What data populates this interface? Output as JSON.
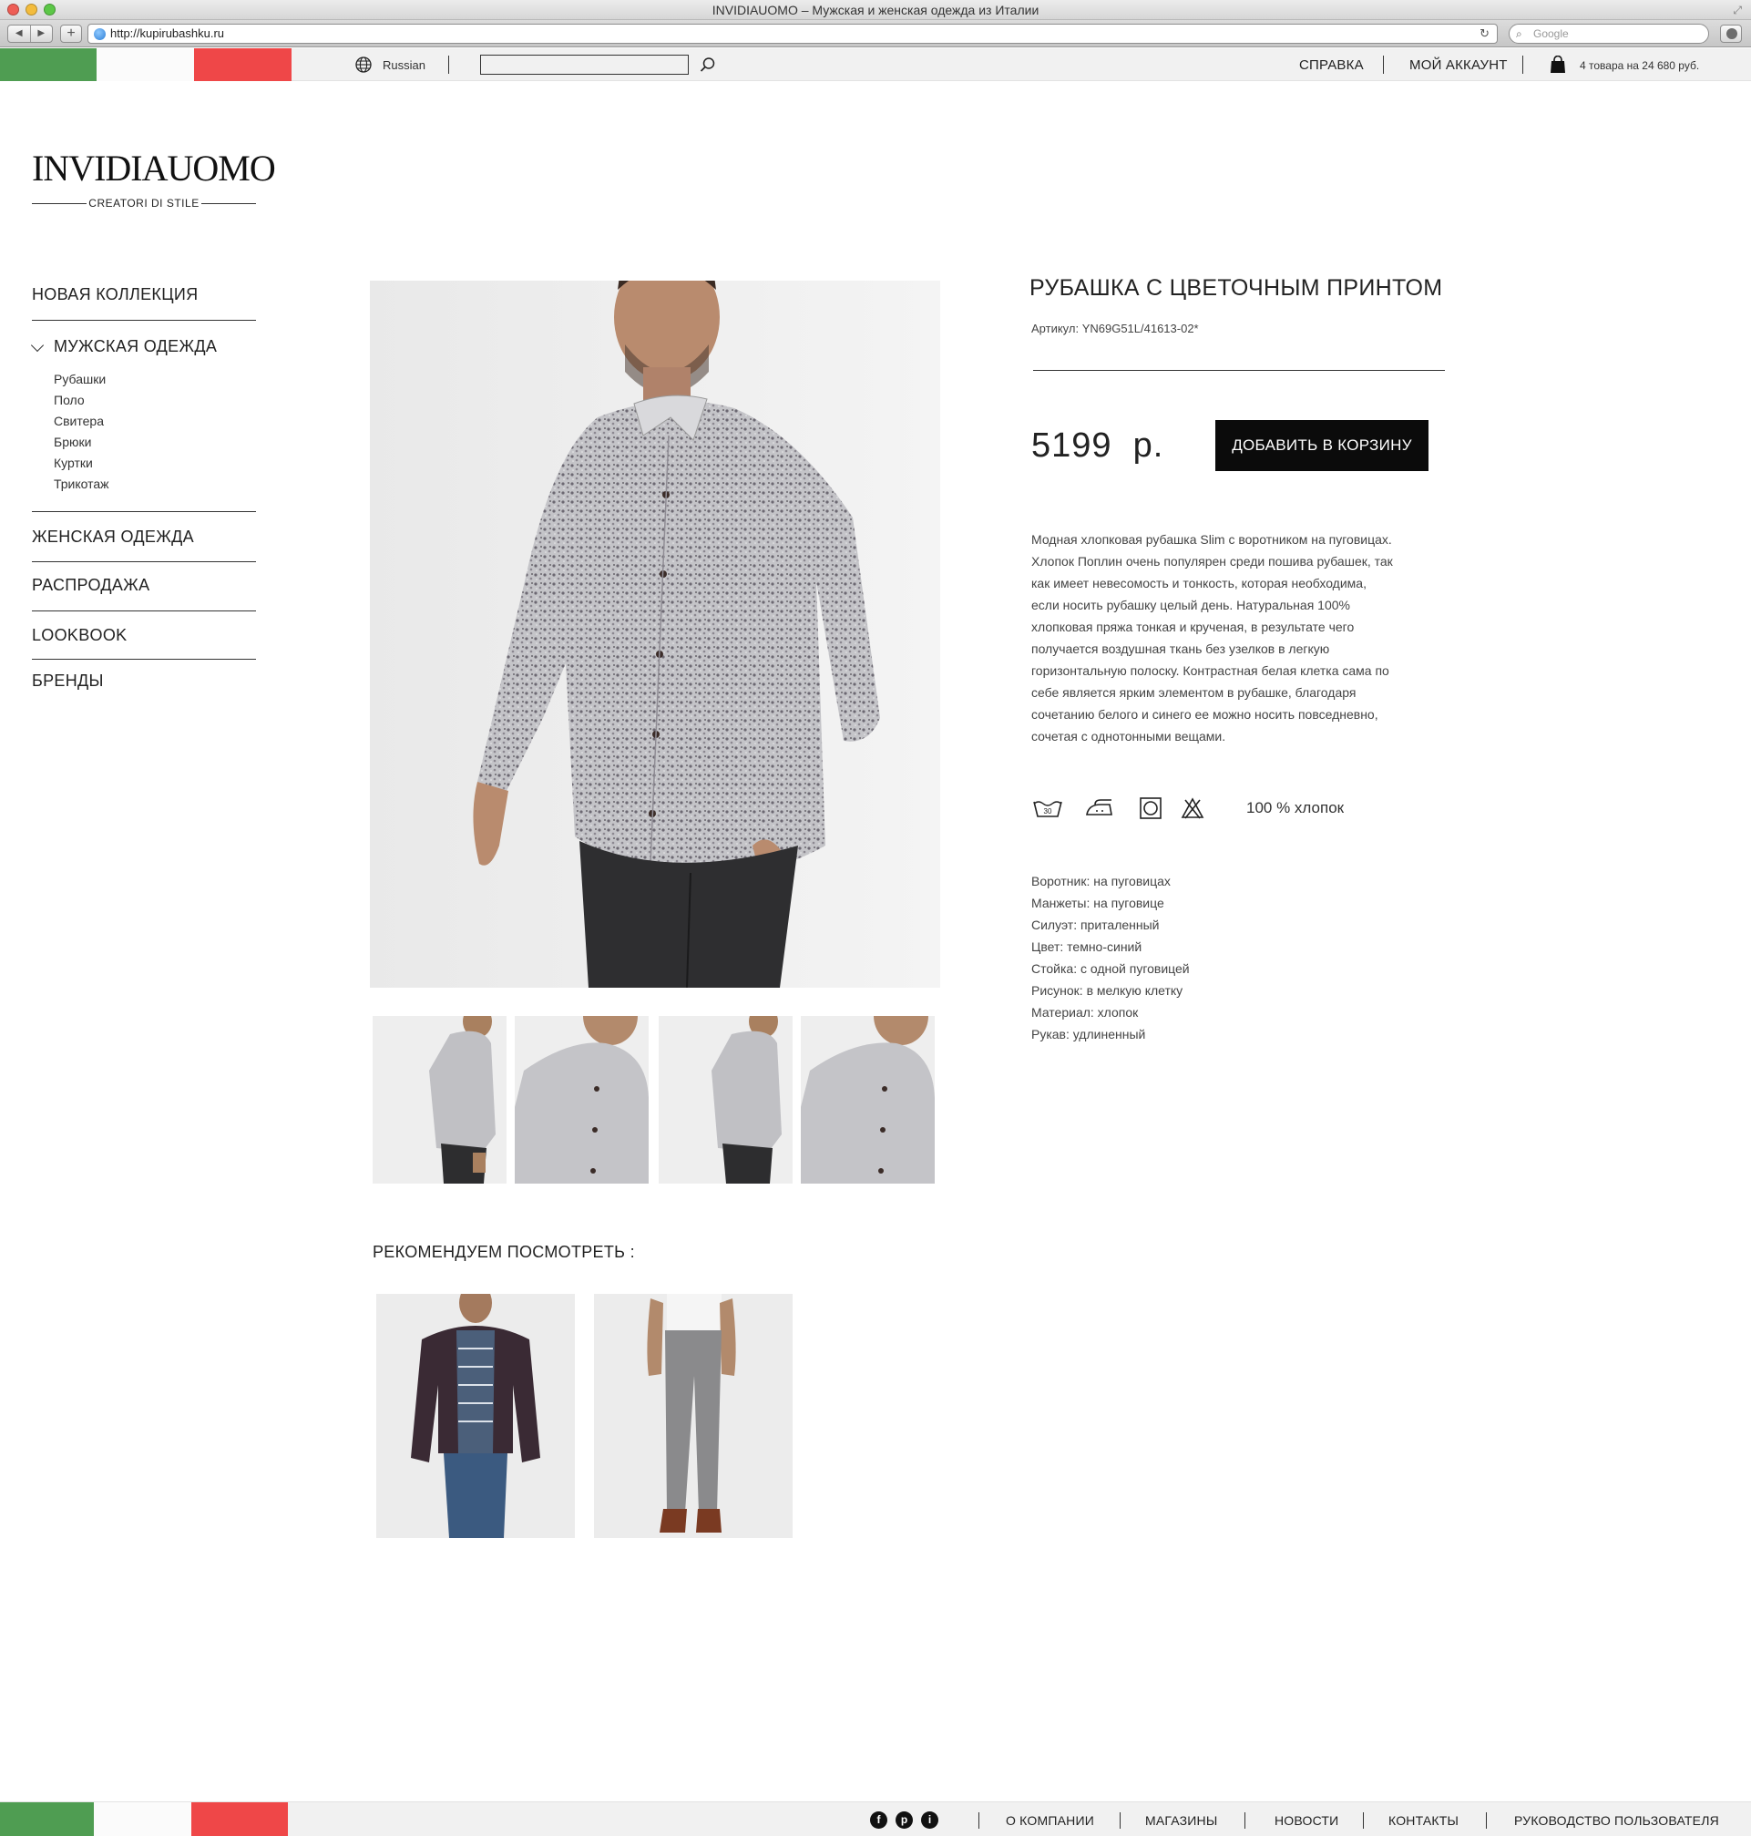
{
  "browser": {
    "window_title": "INVIDIAUOMO – Мужская и женская одежда из Италии",
    "url": "http://kupirubashku.ru",
    "search_placeholder": "Google"
  },
  "topbar": {
    "language": "Russian",
    "search_value": "",
    "links": [
      "СПРАВКА",
      "МОЙ АККАУНТ"
    ],
    "cart_summary": "4 товара на 24 680 руб.",
    "flag_colors": [
      "#4f9d52",
      "#fbfbfb",
      "#ef4748"
    ]
  },
  "logo": {
    "name": "INVIDIAUOMO",
    "tagline": "CREATORI DI STILE"
  },
  "sidebar": {
    "new_collection": "НОВАЯ КОЛЛЕКЦИЯ",
    "mens": "МУЖСКАЯ ОДЕЖДА",
    "mens_sub": [
      "Рубашки",
      "Поло",
      "Свитера",
      "Брюки",
      "Куртки",
      "Трикотаж"
    ],
    "womens": "ЖЕНСКАЯ ОДЕЖДА",
    "sale": "РАСПРОДАЖА",
    "lookbook": "LOOKBOOK",
    "brands": "БРЕНДЫ"
  },
  "product": {
    "title": "РУБАШКА С ЦВЕТОЧНЫМ ПРИНТОМ",
    "sku": "Артикул: YN69G51L/41613-02*",
    "price": "5199  р.",
    "add_to_cart": "ДОБАВИТЬ В КОРЗИНУ",
    "description_lines": [
      "Модная хлопковая  рубашка Slim с воротником на пуговицах.",
      "Хлопок Поплин очень популярен среди пошива рубашек, так",
      "как имеет  невесомость и тонкость, которая необходима,",
      "если носить рубашку целый день. Натуральная 100%",
      "хлопковая пряжа тонкая и крученая, в результате чего",
      "получается воздушная ткань без узелков в легкую",
      "горизонтальную полоску. Контрастная белая  клетка сама по",
      "себе является ярким элементом в рубашке, благодаря",
      "сочетанию белого и синего ее можно носить  повседневно,",
      "сочетая с однотонными вещами."
    ],
    "care_icons": [
      "wash-30-icon",
      "iron-icon",
      "tumble-dry-icon",
      "no-bleach-icon"
    ],
    "wash_temp": "30",
    "material": "100 % хлопок",
    "specs": [
      "Воротник: на пуговицах",
      "Манжеты: на пуговице",
      "Силуэт: приталенный",
      "Цвет: темно-синий",
      "Стойка: с одной пуговицей",
      "Рисунок: в мелкую клетку",
      "Материал: хлопок",
      "Рукав: удлиненный"
    ]
  },
  "recommend": {
    "title": "РЕКОМЕНДУЕМ ПОСМОТРЕТЬ :"
  },
  "footer": {
    "social": [
      "f",
      "p",
      "i"
    ],
    "links": [
      "О КОМПАНИИ",
      "МАГАЗИНЫ",
      "НОВОСТИ",
      "КОНТАКТЫ",
      "РУКОВОДСТВО ПОЛЬЗОВАТЕЛЯ"
    ]
  }
}
